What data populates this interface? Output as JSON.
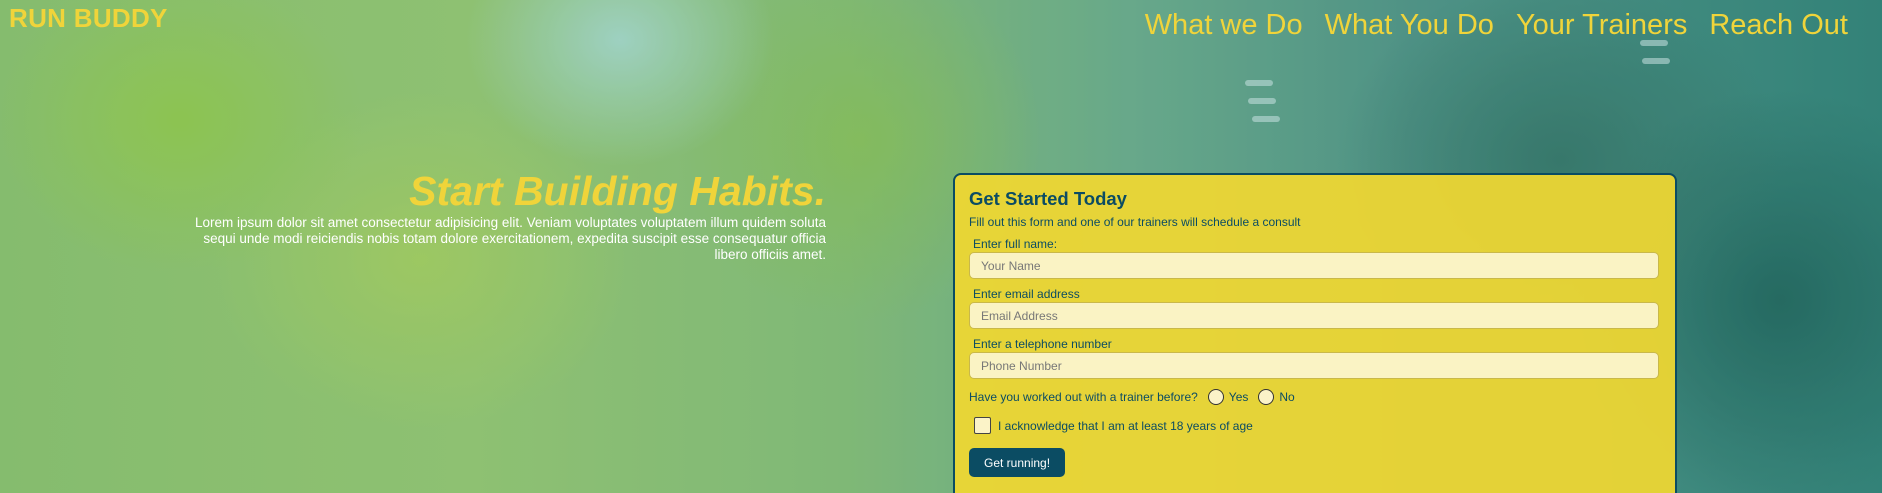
{
  "brand": "RUN BUDDY",
  "nav": {
    "items": [
      "What we Do",
      "What You Do",
      "Your Trainers",
      "Reach Out"
    ]
  },
  "hero": {
    "title": "Start Building Habits.",
    "body": "Lorem ipsum dolor sit amet consectetur adipisicing elit. Veniam voluptates voluptatem illum quidem soluta sequi unde modi reiciendis nobis totam dolore exercitationem, expedita suscipit esse consequatur officia libero officiis amet."
  },
  "form": {
    "title": "Get Started Today",
    "subtitle": "Fill out this form and one of our trainers will schedule a consult",
    "name": {
      "label": "Enter full name:",
      "placeholder": "Your Name",
      "value": ""
    },
    "email": {
      "label": "Enter email address",
      "placeholder": "Email Address",
      "value": ""
    },
    "phone": {
      "label": "Enter a telephone number",
      "placeholder": "Phone Number",
      "value": ""
    },
    "trainer_question": "Have you worked out with a trainer before?",
    "trainer_options": [
      "Yes",
      "No"
    ],
    "age_ack": "I acknowledge that I am at least 18 years of age",
    "submit_label": "Get running!"
  },
  "colors": {
    "accent_yellow": "#f0d43a",
    "dark_teal": "#0b4c63",
    "form_bg": "#f0d732"
  }
}
